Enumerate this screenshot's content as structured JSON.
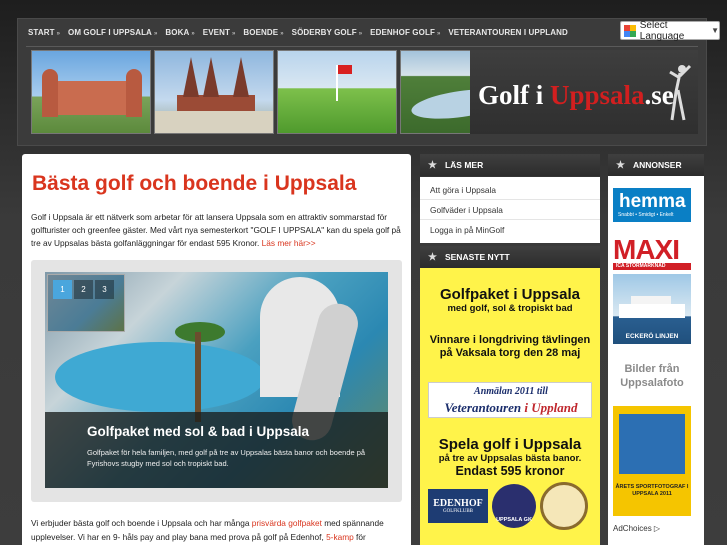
{
  "nav": [
    {
      "label": "START",
      "arrow": "»"
    },
    {
      "label": "OM GOLF I UPPSALA",
      "arrow": "»"
    },
    {
      "label": "BOKA",
      "arrow": "»"
    },
    {
      "label": "EVENT",
      "arrow": "»"
    },
    {
      "label": "BOENDE",
      "arrow": "»"
    },
    {
      "label": "SÖDERBY GOLF",
      "arrow": "»"
    },
    {
      "label": "EDENHOF GOLF",
      "arrow": "»"
    },
    {
      "label": "VETERANTOUREN I UPPLAND",
      "arrow": ""
    }
  ],
  "language": {
    "label": "Select Language",
    "caret": "▼"
  },
  "logo": {
    "part1": "Golf i ",
    "part2": "Uppsala",
    "part3": ".se"
  },
  "main": {
    "title": "Bästa golf och boende i Uppsala",
    "intro": "Golf i Uppsala är ett nätverk som arbetar för att lansera Uppsala som en attraktiv sommarstad för golfturister och greenfee gäster. Med vårt nya semesterkort \"GOLF I UPPSALA\" kan du spela golf på tre av Uppsalas bästa golfanläggningar för endast 595 Kronor.",
    "intro_link": "Läs mer här>>",
    "slider": {
      "dots": [
        "1",
        "2",
        "3"
      ],
      "caption_title": "Golfpaket med sol & bad i Uppsala",
      "caption_text": "Golfpaket för hela familjen, med golf på tre av Uppsalas bästa banor och boende på Fyrishovs stugby med sol och tropiskt bad."
    },
    "bottom_text_1": "Vi erbjuder bästa golf och boende i Uppsala och har många ",
    "bottom_link_1": "prisvärda golfpaket",
    "bottom_text_2": " med spännande upplevelser. Vi har en 9- håls pay and play bana med prova på golf på Edenhof, ",
    "bottom_link_2": "5-kamp",
    "bottom_text_3": " för"
  },
  "sidebar": {
    "star": "★",
    "las_mer_title": "LÄS MER",
    "las_mer_links": [
      "Att göra i Uppsala",
      "Golfväder i Uppsala",
      "Logga in på MinGolf"
    ],
    "senaste_title": "SENASTE NYTT",
    "news": {
      "headline": "Golfpaket i Uppsala",
      "sub": "med golf, sol & tropiskt bad",
      "item2": "Vinnare i longdriving tävlingen på Vaksala torg den 28 maj",
      "vet_line1": "Anmälan 2011 till",
      "vet_line2a": "Veterantouren",
      "vet_line2b": " i Uppland",
      "spela_h": "Spela golf i Uppsala",
      "spela_1": "på tre av Uppsalas bästa banor.",
      "spela_2": "Endast 595 kronor",
      "edenhof": "EDENHOF",
      "edenhof_sub": "GOLFKLUBB",
      "seal_text": "UPPSALA GK"
    }
  },
  "ads": {
    "title": "ANNONSER",
    "star": "★",
    "hemma_big": "hemma",
    "hemma_small": "Snabbt • Smidigt • Enkelt",
    "maxi_big": "MAXI",
    "maxi_sub": "ICA STORMARKNAD",
    "ship_label": "ECKERÖ LINJEN",
    "foto": "Bilder från Uppsalafoto",
    "sport": "ÅRETS SPORTFOTOGRAF I UPPSALA 2011",
    "adchoices": "AdChoices ▷"
  }
}
